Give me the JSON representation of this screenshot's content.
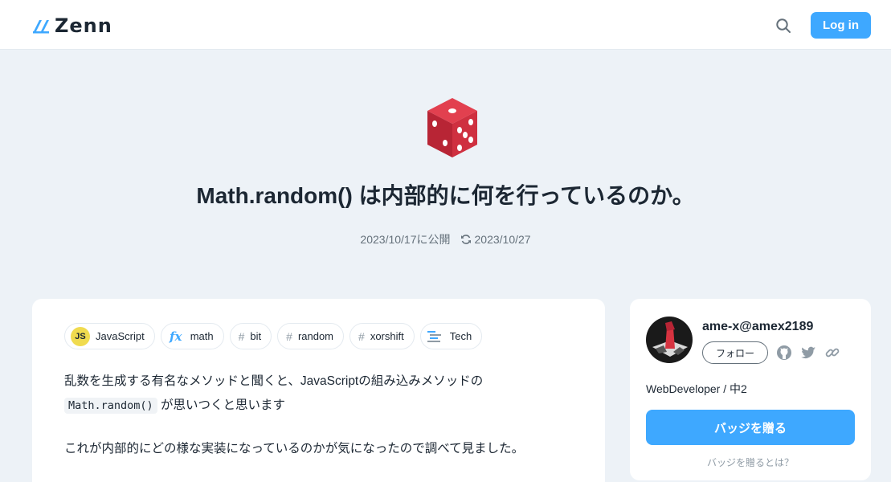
{
  "header": {
    "logo_text": "Zenn",
    "search_icon": "search-icon",
    "login_label": "Log in",
    "accent_color": "#3ea8ff"
  },
  "article": {
    "emoji": "game-die",
    "title": "Math.random() は内部的に何を行っているのか。",
    "published": "2023/10/17に公開",
    "updated": "2023/10/27",
    "tags": [
      {
        "label": "JavaScript",
        "icon": "javascript-icon"
      },
      {
        "label": "math",
        "icon": "fx-icon"
      },
      {
        "label": "bit",
        "icon": "hash-icon"
      },
      {
        "label": "random",
        "icon": "hash-icon"
      },
      {
        "label": "xorshift",
        "icon": "hash-icon"
      },
      {
        "label": "Tech",
        "icon": "tech-icon"
      }
    ],
    "paragraph1_line1": "乱数を生成する有名なメソッドと聞くと、JavaScriptの組み込みメソッドの",
    "paragraph1_code": "Math.random()",
    "paragraph1_line2_rest": "が思いつくと思います",
    "paragraph2": "これが内部的にどの様な実装になっているのかが気になったので調べて見ました。"
  },
  "author": {
    "name": "ame-x@amex2189",
    "follow_label": "フォロー",
    "social_icons": [
      "github-icon",
      "twitter-icon",
      "link-icon"
    ],
    "bio": "WebDeveloper / 中2",
    "badge_label": "バッジを贈る",
    "badge_help": "バッジを贈るとは？"
  }
}
